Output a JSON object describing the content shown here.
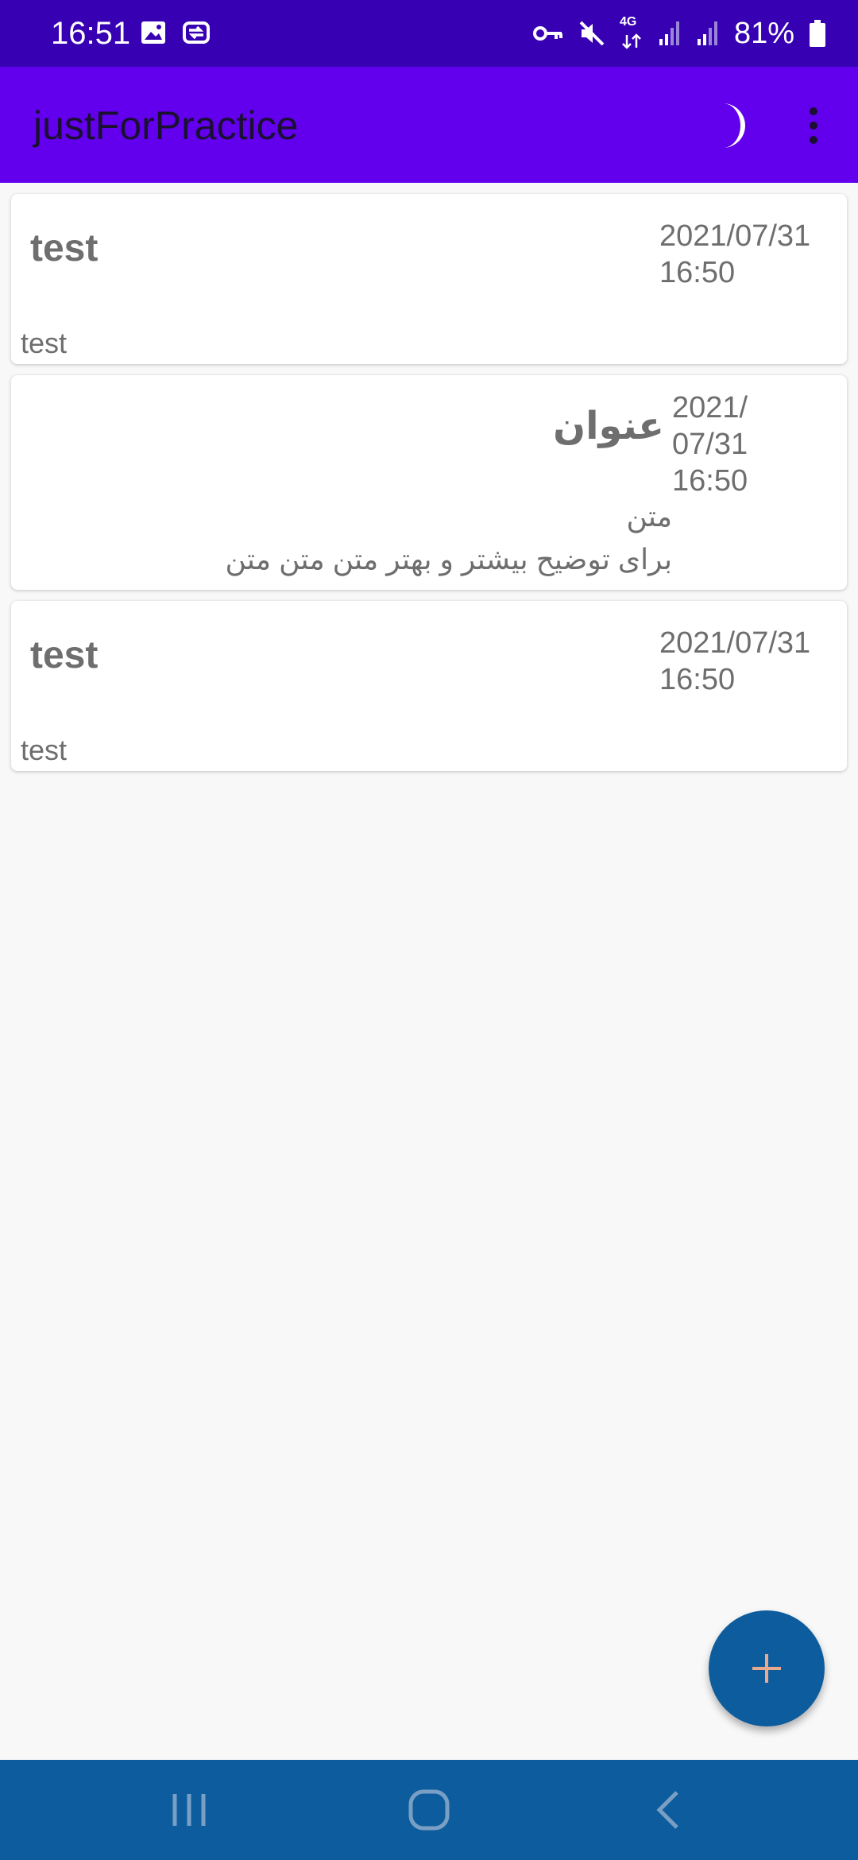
{
  "status_bar": {
    "time": "16:51",
    "battery": "81%",
    "network_label": "4G",
    "icons": [
      "image-icon",
      "cast-icon",
      "key-icon",
      "mute-icon",
      "network-4g-icon",
      "signal-icon",
      "signal-icon",
      "battery-icon"
    ]
  },
  "app_bar": {
    "title": "justForPractice",
    "actions": [
      "moon-icon",
      "more-vert-icon"
    ]
  },
  "notes": [
    {
      "title": "test",
      "date": "2021/07/31\n16:50",
      "body": "test"
    },
    {
      "title": "عنوان",
      "date": "2021/\n07/31\n16:50",
      "body_line1": "متن",
      "body_line2": "برای توضیح بیشتر و بهتر متن متن متن"
    },
    {
      "title": "test",
      "date": "2021/07/31\n16:50",
      "body": "test"
    }
  ],
  "fab": {
    "icon": "plus-icon"
  },
  "nav_bar": {
    "buttons": [
      "recent-apps-icon",
      "home-icon",
      "back-icon"
    ]
  },
  "colors": {
    "status_bar": "#3700b3",
    "app_bar": "#6200ee",
    "fab": "#0d5d9e",
    "nav_bar": "#0d5d9e",
    "background": "#f8f8f8"
  }
}
